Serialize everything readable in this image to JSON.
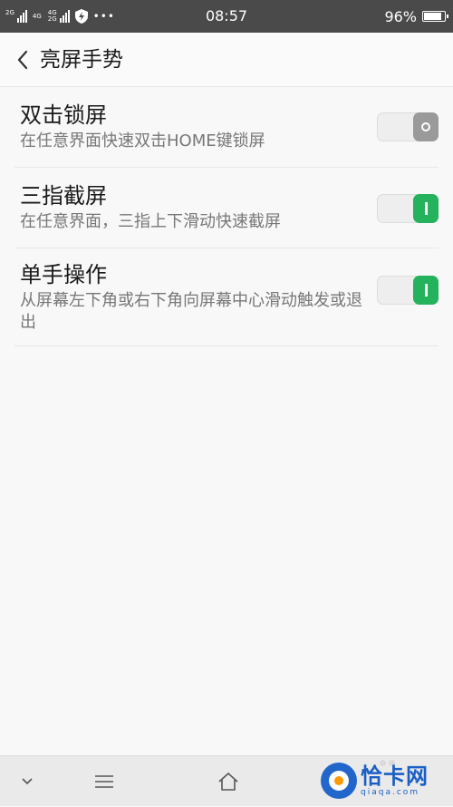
{
  "status_bar": {
    "sim1_label": "2G",
    "sim2_label": "4G",
    "sim3_label": "4G",
    "sim3_sub": "2G",
    "more_label": "•••",
    "time": "08:57",
    "battery_text": "96%",
    "battery_level": 0.96
  },
  "header": {
    "back_icon": "chevron-left-icon",
    "title": "亮屏手势"
  },
  "settings": [
    {
      "title": "双击锁屏",
      "desc": "在任意界面快速双击HOME键锁屏",
      "enabled": false
    },
    {
      "title": "三指截屏",
      "desc": "在任意界面，三指上下滑动快速截屏",
      "enabled": true
    },
    {
      "title": "单手操作",
      "desc": "从屏幕左下角或右下角向屏幕中心滑动触发或退出",
      "enabled": true
    }
  ],
  "nav": {
    "icons": [
      "chevron-down-icon",
      "menu-icon",
      "home-icon"
    ]
  },
  "watermark": {
    "name": "恰卡网",
    "domain": "qiaqa.com"
  },
  "colors": {
    "status_bar": "#4a4a4a",
    "toggle_on": "#25b25c",
    "toggle_off": "#9a9a9a",
    "watermark": "#1b5fc5"
  }
}
